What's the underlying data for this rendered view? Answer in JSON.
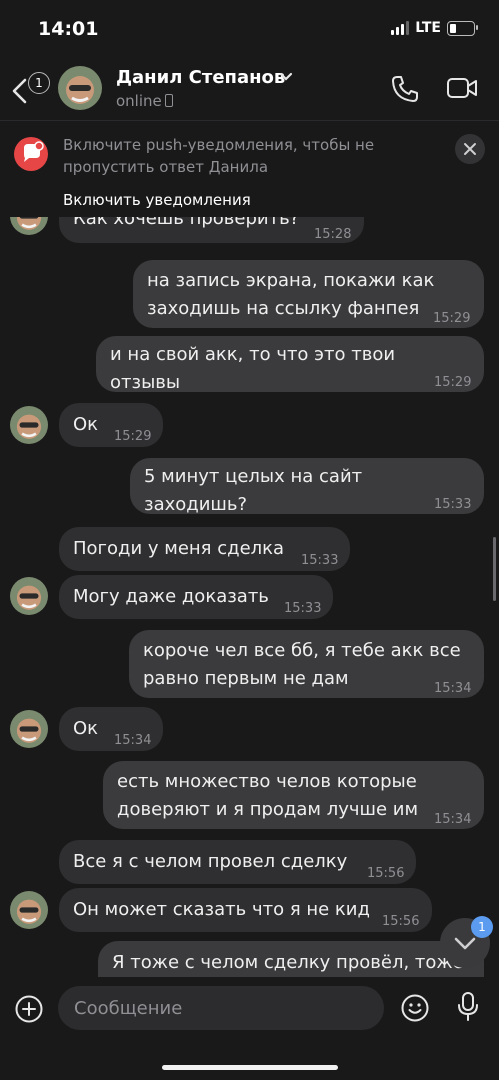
{
  "status_bar": {
    "time": "14:01",
    "network": "LTE"
  },
  "header": {
    "back_badge": "1",
    "contact_name": "Данил Степанов",
    "presence": "online"
  },
  "banner": {
    "text": "Включите push-уведомления, чтобы не пропустить ответ Данила",
    "action": "Включить уведомления"
  },
  "messages": [
    {
      "dir": "in",
      "text": "Как хочешь проверить?",
      "time": "15:28"
    },
    {
      "dir": "out",
      "text": "на запись экрана, покажи как заходишь на ссылку фанпея",
      "time": "15:29"
    },
    {
      "dir": "out",
      "text": "и на свой акк, то что это твои отзывы",
      "time": "15:29"
    },
    {
      "dir": "in",
      "text": "Ок",
      "time": "15:29"
    },
    {
      "dir": "out",
      "text": "5 минут целых на сайт заходишь?",
      "time": "15:33"
    },
    {
      "dir": "in",
      "text": "Погоди у меня сделка",
      "time": "15:33"
    },
    {
      "dir": "in",
      "text": "Могу даже доказать",
      "time": "15:33"
    },
    {
      "dir": "out",
      "text": "короче чел все бб, я тебе акк все равно первым не дам",
      "time": "15:34"
    },
    {
      "dir": "in",
      "text": "Ок",
      "time": "15:34"
    },
    {
      "dir": "out",
      "text": "есть множество челов которые доверяют и я продам лучше им",
      "time": "15:34"
    },
    {
      "dir": "in",
      "text": "Все я с челом провел сделку",
      "time": "15:56"
    },
    {
      "dir": "in",
      "text": "Он может сказать что я не кид",
      "time": "15:56"
    },
    {
      "dir": "out",
      "text": "Я тоже с челом сделку провёл, тоже",
      "time": ""
    }
  ],
  "scroll_down_badge": "1",
  "composer": {
    "placeholder": "Сообщение"
  },
  "colors": {
    "accent": "#5b9cf0",
    "banner_icon": "#e64646",
    "bubble_in": "#2f2f31",
    "bubble_out": "#3b3b3d"
  }
}
